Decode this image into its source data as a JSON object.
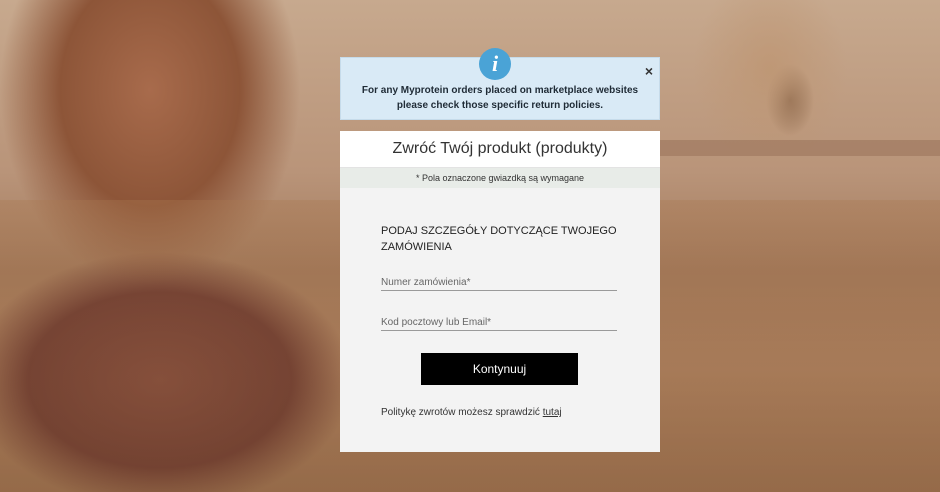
{
  "notice": {
    "icon": "info-icon",
    "icon_glyph": "i",
    "close_glyph": "×",
    "text": "For any Myprotein orders placed on marketplace websites please check those specific return policies."
  },
  "form": {
    "title": "Zwróć Twój produkt (produkty)",
    "required_note": "* Pola oznaczone gwiazdką są wymagane",
    "heading": "PODAJ SZCZEGÓŁY DOTYCZĄCE TWOJEGO ZAMÓWIENIA",
    "order_number_placeholder": "Numer zamówienia*",
    "postcode_email_placeholder": "Kod pocztowy lub Email*",
    "submit_label": "Kontynuuj",
    "policy_text": "Politykę zwrotów możesz sprawdzić ",
    "policy_link": "tutaj"
  },
  "colors": {
    "notice_bg": "#d9eaf6",
    "info_icon": "#4aa3d6",
    "button_bg": "#000000"
  }
}
